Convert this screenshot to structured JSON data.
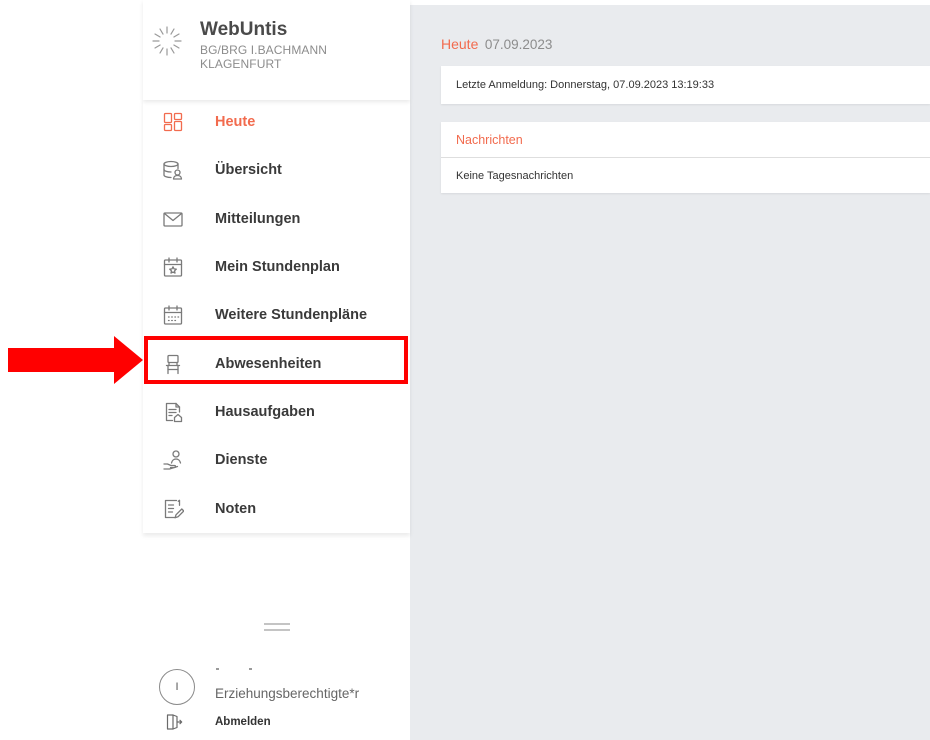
{
  "app": {
    "name": "WebUntis",
    "school_line1": "BG/BRG I.BACHMANN",
    "school_line2": "KLAGENFURT",
    "logo_icon": "sunburst-logo-icon"
  },
  "nav": {
    "items": [
      {
        "label": "Heute",
        "icon": "dashboard-icon",
        "active": true
      },
      {
        "label": "Übersicht",
        "icon": "database-user-icon",
        "active": false
      },
      {
        "label": "Mitteilungen",
        "icon": "envelope-icon",
        "active": false
      },
      {
        "label": "Mein Stundenplan",
        "icon": "calendar-star-icon",
        "active": false
      },
      {
        "label": "Weitere Stundenpläne",
        "icon": "calendar-grid-icon",
        "active": false
      },
      {
        "label": "Abwesenheiten",
        "icon": "chair-icon",
        "active": false,
        "highlighted": true
      },
      {
        "label": "Hausaufgaben",
        "icon": "document-house-icon",
        "active": false
      },
      {
        "label": "Dienste",
        "icon": "person-hand-icon",
        "active": false
      },
      {
        "label": "Noten",
        "icon": "document-pencil-icon",
        "active": false
      }
    ],
    "collapse_icon": "drag-handle-icon"
  },
  "user": {
    "avatar_initial": "I",
    "role": "Erziehungsberechtigte*r",
    "logout_label": "Abmelden",
    "logout_icon": "logout-door-icon"
  },
  "main": {
    "title": "Heute",
    "date": "07.09.2023",
    "last_login": "Letzte Anmeldung: Donnerstag, 07.09.2023 13:19:33",
    "messages": {
      "title": "Nachrichten",
      "empty_text": "Keine Tagesnachrichten"
    }
  },
  "colors": {
    "accent": "#f26b4e",
    "text": "#333333",
    "muted": "#8c8c8c",
    "content_background": "#e9ebee",
    "annotation": "#ff0000"
  }
}
